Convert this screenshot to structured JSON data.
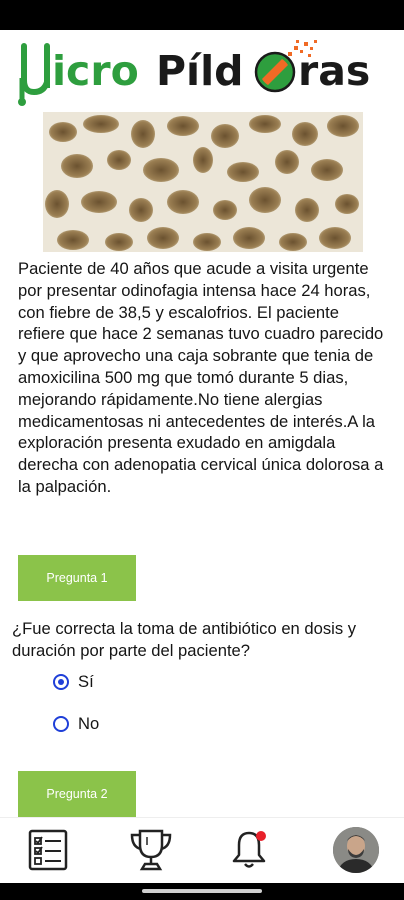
{
  "app": {
    "logo_part1": "icro",
    "logo_part2": "Píld",
    "logo_part3": "ras",
    "brand_green": "#2e9e3e",
    "brand_orange": "#f06a25",
    "hero_image": "trabecular-bone-microscopy"
  },
  "case": {
    "text": "Paciente de 40 años que acude a visita urgente por presentar odinofagia intensa hace 24 horas, con fiebre de 38,5 y escalofrios. El paciente refiere que hace 2 semanas tuvo cuadro parecido y que aprovecho una caja sobrante que tenia de amoxicilina 500 mg que tomó durante 5 dias, mejorando rápidamente.No tiene alergias medicamentosas ni antecedentes de interés.A la exploración presenta exudado en amigdala derecha con adenopatia cervical única dolorosa a la palpación."
  },
  "quiz": {
    "button1_label": "Pregunta 1",
    "question1": "¿Fue correcta la toma de antibiótico en dosis y duración por parte del paciente?",
    "options": [
      {
        "label": "Sí",
        "checked": true
      },
      {
        "label": "No",
        "checked": false
      }
    ],
    "button2_label": "Pregunta 2",
    "button_color": "#8bc34a",
    "radio_color": "#1f3fd8"
  },
  "bottom_nav": {
    "items": [
      "checklist-icon",
      "trophy-icon",
      "bell-icon",
      "avatar"
    ],
    "notification_dot_color": "#e8202a"
  }
}
